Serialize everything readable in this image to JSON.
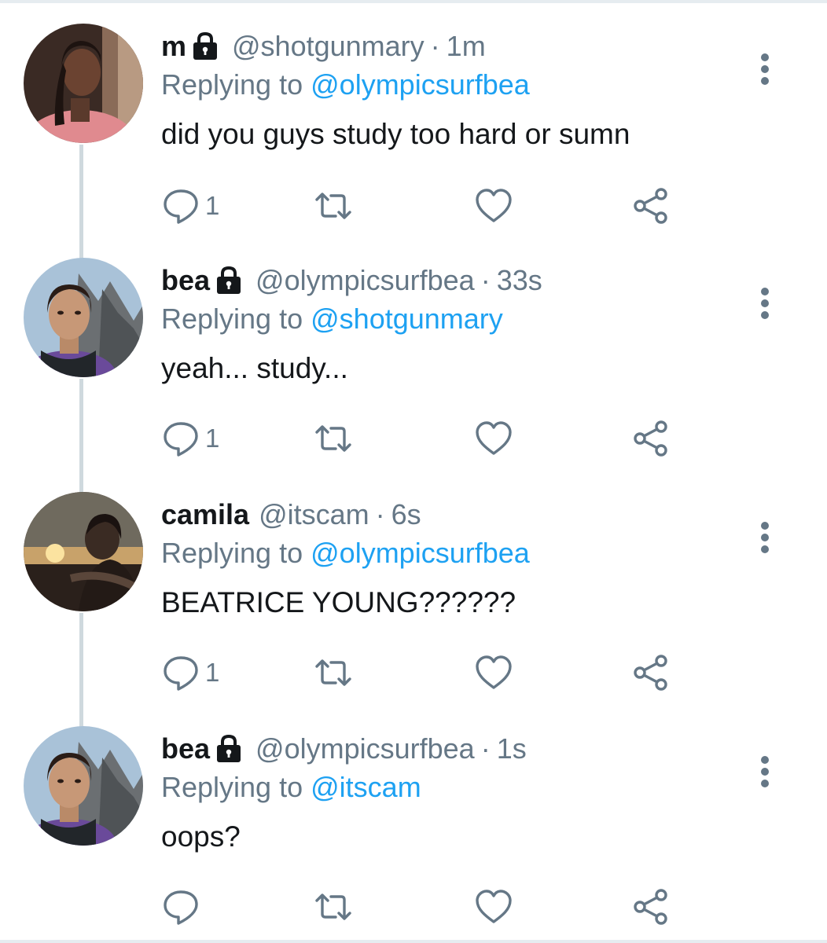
{
  "colors": {
    "accent": "#1da1f2",
    "text_primary": "#14171a",
    "text_secondary": "#657786",
    "thread_line": "#cfd9de",
    "divider": "#e6ecf0"
  },
  "icons": {
    "lock": "lock-icon",
    "more": "vertical-dots-icon",
    "reply": "speech-bubble-icon",
    "retweet": "retweet-arrows-icon",
    "like": "heart-icon",
    "share": "share-icon"
  },
  "tweets": [
    {
      "display_name": "m",
      "protected": true,
      "handle": "@shotgunmary",
      "dot": "·",
      "time": "1m",
      "replying_prefix": "Replying to",
      "replying_to": "@olympicsurfbea",
      "text": "did you guys study too hard or sumn",
      "reply_count": "1"
    },
    {
      "display_name": "bea",
      "protected": true,
      "handle": "@olympicsurfbea",
      "dot": "·",
      "time": "33s",
      "replying_prefix": "Replying to",
      "replying_to": "@shotgunmary",
      "text": "yeah... study...",
      "reply_count": "1"
    },
    {
      "display_name": "camila",
      "protected": false,
      "handle": "@itscam",
      "dot": "·",
      "time": "6s",
      "replying_prefix": "Replying to",
      "replying_to": "@olympicsurfbea",
      "text": "BEATRICE YOUNG??????",
      "reply_count": "1"
    },
    {
      "display_name": "bea",
      "protected": true,
      "handle": "@olympicsurfbea",
      "dot": "·",
      "time": "1s",
      "replying_prefix": "Replying to",
      "replying_to": "@itscam",
      "text": "oops?",
      "reply_count": ""
    }
  ]
}
